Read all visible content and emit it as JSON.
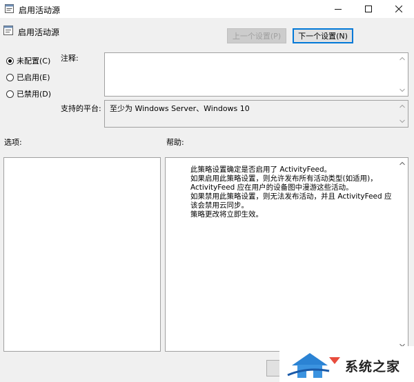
{
  "window": {
    "title": "启用活动源"
  },
  "header": {
    "policy_title": "启用活动源",
    "prev_label": "上一个设置(P)",
    "next_label": "下一个设置(N)"
  },
  "state": {
    "options": [
      {
        "label": "未配置(C)",
        "selected": true
      },
      {
        "label": "已启用(E)",
        "selected": false
      },
      {
        "label": "已禁用(D)",
        "selected": false
      }
    ]
  },
  "comment": {
    "label": "注释:",
    "value": ""
  },
  "platform": {
    "label": "支持的平台:",
    "value": "至少为 Windows Server、Windows 10"
  },
  "options_panel": {
    "label": "选项:"
  },
  "help": {
    "label": "帮助:",
    "paragraphs": [
      "此策略设置确定是否启用了 ActivityFeed。",
      "如果启用此策略设置，则允许发布所有活动类型(如适用)，ActivityFeed 应在用户的设备图中漫游这些活动。",
      "如果禁用此策略设置，则无法发布活动，并且 ActivityFeed 应该会禁用云同步。",
      "策略更改将立即生效。"
    ]
  },
  "watermark": {
    "text": "系统之家"
  }
}
